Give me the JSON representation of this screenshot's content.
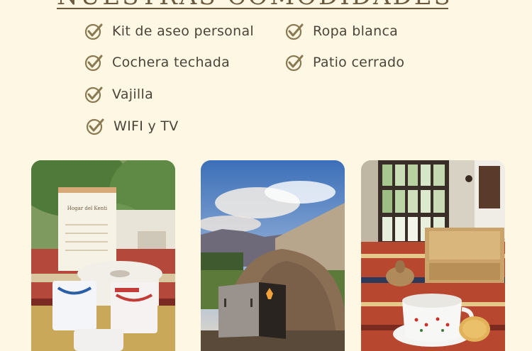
{
  "heading": "NUESTRAS COMODIDADES",
  "amenities": {
    "left": [
      {
        "label": "Kit de aseo personal"
      },
      {
        "label": "Cochera techada"
      },
      {
        "label": "Vajilla"
      },
      {
        "label": "WIFI y TV"
      }
    ],
    "right": [
      {
        "label": "Ropa blanca"
      },
      {
        "label": "Patio cerrado"
      }
    ]
  },
  "photos": {
    "kit": {
      "card_title": "Hogar del Kenti"
    },
    "oven": {},
    "breakfast": {}
  },
  "colors": {
    "background": "#fdf7e4",
    "accent": "#8a7a52",
    "text": "#4d433a"
  },
  "icons": {
    "amenity_check": "check-circle-icon"
  }
}
